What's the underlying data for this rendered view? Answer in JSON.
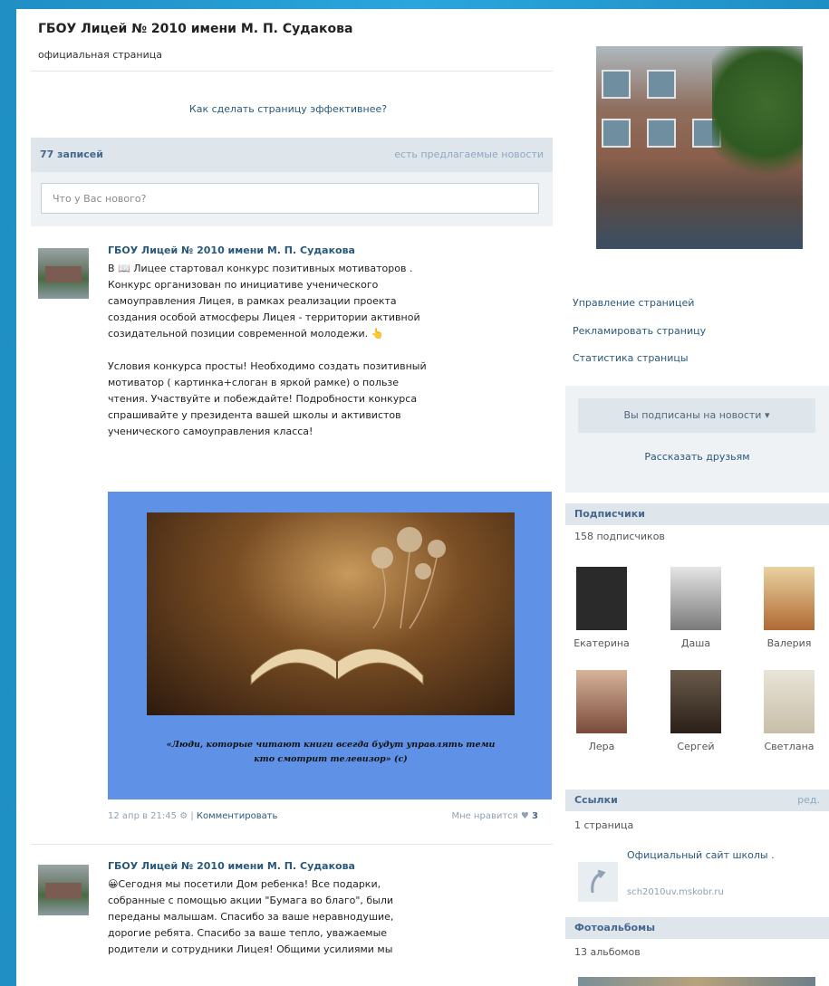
{
  "page": {
    "title": "ГБОУ Лицей № 2010 имени М. П. Судакова",
    "subtitle": "официальная страница",
    "effectiveness_link": "Как сделать страницу эффективнее?"
  },
  "wall": {
    "posts_count": "77 записей",
    "suggested_news": "есть предлагаемые новости",
    "new_post_placeholder": "Что у Вас нового?"
  },
  "posts": [
    {
      "author": "ГБОУ Лицей № 2010 имени М. П. Судакова",
      "text": "В 📖 Лицее стартовал конкурс позитивных мотиваторов .\nКонкурс организован по инициативе ученического\nсамоуправления Лицея, в рамках реализации проекта\nсоздания особой атмосферы Лицея - территории активной\nсозидательной позиции современной молодежи. 👆\n\nУсловия конкурса просты! Необходимо создать позитивный\nмотиватор ( картинка+слоган в яркой рамке) о пользе\nчтения. Участвуйте и побеждайте! Подробности конкурса\nспрашивайте у президента вашей школы и активистов\nученического самоуправления класса!",
      "image_caption": "«Люди, которые читают книги всегда будут управлять теми\nкто смотрит телевизор» (с)",
      "date": "12 апр в 21:45",
      "comment_label": "Комментировать",
      "like_label": "Мне нравится",
      "like_count": "3"
    },
    {
      "author": "ГБОУ Лицей № 2010 имени М. П. Судакова",
      "text": "😀Сегодня мы посетили Дом ребенка! Все подарки,\nсобранные с помощью акции \"Бумага во благо\", были\nпереданы малышам. Спасибо за ваше неравнодушие,\nдорогие ребята. Спасибо за ваше тепло, уважаемые\nродители и сотрудники Лицея! Общими усилиями мы"
    }
  ],
  "sidebar": {
    "manage": "Управление страницей",
    "advertise": "Рекламировать страницу",
    "stats": "Статистика страницы",
    "subscribed_button": "Вы подписаны на новости ▾",
    "tell_friends": "Рассказать друзьям",
    "subscribers_title": "Подписчики",
    "subscribers_count": "158 подписчиков",
    "members": [
      {
        "name": "Екатерина",
        "color": "#2a2a2a"
      },
      {
        "name": "Даша",
        "color": "#9a9a9a"
      },
      {
        "name": "Валерия",
        "color": "#c98a4a"
      },
      {
        "name": "Лера",
        "color": "#b8866a"
      },
      {
        "name": "Сергей",
        "color": "#4a3a2a"
      },
      {
        "name": "Светлана",
        "color": "#d8d2c2"
      }
    ],
    "links_title": "Ссылки",
    "links_edit": "ред.",
    "links_count": "1 страница",
    "link_title": "Официальный сайт школы .",
    "link_url": "sch2010uv.mskobr.ru",
    "albums_title": "Фотоальбомы",
    "albums_count": "13 альбомов"
  }
}
